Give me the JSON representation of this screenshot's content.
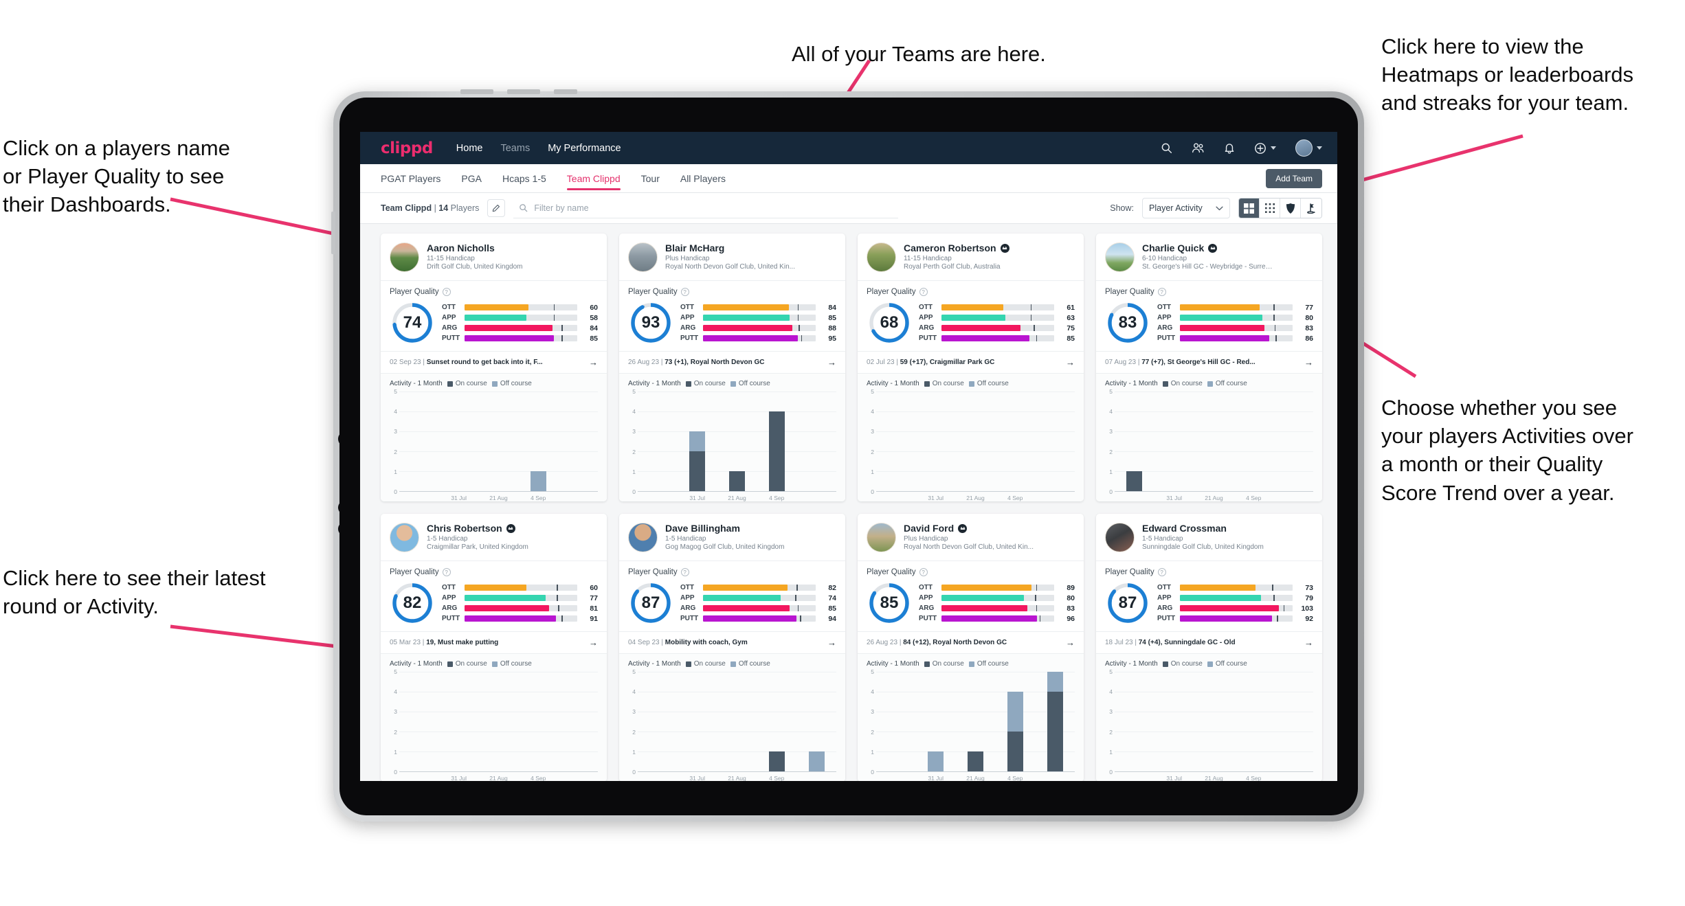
{
  "annotations": [
    {
      "id": "a-top",
      "text": "All of your Teams are here."
    },
    {
      "id": "a-topright",
      "text": "Click here to view the\nHeatmaps or leaderboards\nand streaks for your team."
    },
    {
      "id": "a-left",
      "text": "Click on a players name\nor Player Quality to see\ntheir Dashboards."
    },
    {
      "id": "a-right",
      "text": "Choose whether you see\nyour players Activities over\na month or their Quality\nScore Trend over a year."
    },
    {
      "id": "a-bottomleft",
      "text": "Click here to see their latest\nround or Activity."
    }
  ],
  "colors": {
    "accent_pink": "#e4316c",
    "navbar_bg": "#16283a",
    "ring_blue": "#1c7fd4",
    "ott": "#f5a623",
    "app": "#35d5b0",
    "arg": "#f2175f",
    "putt": "#b915d0",
    "on_course": "#4a5a68",
    "off_course": "#8fa8bf"
  },
  "navbar": {
    "logo": "clippd",
    "links": [
      {
        "label": "Home",
        "state": "active"
      },
      {
        "label": "Teams",
        "state": "dim"
      },
      {
        "label": "My Performance",
        "state": "active"
      }
    ],
    "icons": [
      "search-icon",
      "people-icon",
      "bell-icon",
      "plus-circle-icon",
      "avatar"
    ]
  },
  "tabs": {
    "items": [
      {
        "label": "PGAT Players",
        "selected": false
      },
      {
        "label": "PGA",
        "selected": false
      },
      {
        "label": "Hcaps 1-5",
        "selected": false
      },
      {
        "label": "Team Clippd",
        "selected": true
      },
      {
        "label": "Tour",
        "selected": false
      },
      {
        "label": "All Players",
        "selected": false
      }
    ],
    "add_team_label": "Add Team"
  },
  "filterbar": {
    "team_name": "Team Clippd",
    "separator": " | ",
    "player_count": "14",
    "players_word": " Players",
    "edit_icon": "pencil-icon",
    "search_placeholder": "Filter by name",
    "show_label": "Show:",
    "show_value": "Player Activity",
    "view_buttons": [
      {
        "name": "grid-large-icon",
        "active": true
      },
      {
        "name": "grid-small-icon",
        "active": false
      },
      {
        "name": "heatmap-shield-icon",
        "active": false
      },
      {
        "name": "flag-leaderboard-icon",
        "active": false
      }
    ]
  },
  "card_labels": {
    "player_quality": "Player Quality",
    "activity": "Activity - 1 Month",
    "on_course": "On course",
    "off_course": "Off course",
    "skills": [
      "OTT",
      "APP",
      "ARG",
      "PUTT"
    ],
    "arrow": "→"
  },
  "chart_data": {
    "type": "bar",
    "title": "Activity - 1 Month",
    "ylabel": "",
    "xlabel": "",
    "ylim": [
      0,
      5
    ],
    "yticks": [
      0,
      1,
      2,
      3,
      4,
      5
    ],
    "categories": [
      "31 Jul",
      "21 Aug",
      "4 Sep"
    ],
    "xtick_labels": [
      "31 Jul",
      "21 Aug",
      "4 Sep"
    ],
    "legend": [
      "On course",
      "Off course"
    ],
    "legend_position": "top",
    "grid": true,
    "per_player": [
      {
        "player": "Aaron Nicholls",
        "bars": [
          {
            "slot": 0,
            "on": 0,
            "off": 0
          },
          {
            "slot": 1,
            "on": 0,
            "off": 0
          },
          {
            "slot": 2,
            "on": 0,
            "off": 0
          },
          {
            "slot": 3,
            "on": 0,
            "off": 1
          },
          {
            "slot": 4,
            "on": 0,
            "off": 0
          }
        ]
      },
      {
        "player": "Blair McHarg",
        "bars": [
          {
            "slot": 0,
            "on": 0,
            "off": 0
          },
          {
            "slot": 1,
            "on": 2,
            "off": 1
          },
          {
            "slot": 2,
            "on": 1,
            "off": 0
          },
          {
            "slot": 3,
            "on": 4,
            "off": 0
          },
          {
            "slot": 4,
            "on": 0,
            "off": 0
          }
        ]
      },
      {
        "player": "Cameron Robertson",
        "bars": [
          {
            "slot": 0,
            "on": 0,
            "off": 0
          },
          {
            "slot": 1,
            "on": 0,
            "off": 0
          },
          {
            "slot": 2,
            "on": 0,
            "off": 0
          },
          {
            "slot": 3,
            "on": 0,
            "off": 0
          },
          {
            "slot": 4,
            "on": 0,
            "off": 0
          }
        ]
      },
      {
        "player": "Charlie Quick",
        "bars": [
          {
            "slot": 0,
            "on": 1,
            "off": 0
          },
          {
            "slot": 1,
            "on": 0,
            "off": 0
          },
          {
            "slot": 2,
            "on": 0,
            "off": 0
          },
          {
            "slot": 3,
            "on": 0,
            "off": 0
          },
          {
            "slot": 4,
            "on": 0,
            "off": 0
          }
        ]
      },
      {
        "player": "Chris Robertson",
        "bars": [
          {
            "slot": 0,
            "on": 0,
            "off": 0
          },
          {
            "slot": 1,
            "on": 0,
            "off": 0
          },
          {
            "slot": 2,
            "on": 0,
            "off": 0
          },
          {
            "slot": 3,
            "on": 0,
            "off": 0
          },
          {
            "slot": 4,
            "on": 0,
            "off": 0
          }
        ]
      },
      {
        "player": "Dave Billingham",
        "bars": [
          {
            "slot": 0,
            "on": 0,
            "off": 0
          },
          {
            "slot": 1,
            "on": 0,
            "off": 0
          },
          {
            "slot": 2,
            "on": 0,
            "off": 0
          },
          {
            "slot": 3,
            "on": 1,
            "off": 0
          },
          {
            "slot": 4,
            "on": 0,
            "off": 1
          }
        ]
      },
      {
        "player": "David Ford",
        "bars": [
          {
            "slot": 0,
            "on": 0,
            "off": 0
          },
          {
            "slot": 1,
            "on": 0,
            "off": 1
          },
          {
            "slot": 2,
            "on": 1,
            "off": 0
          },
          {
            "slot": 3,
            "on": 2,
            "off": 2
          },
          {
            "slot": 4,
            "on": 4,
            "off": 1
          }
        ]
      },
      {
        "player": "Edward Crossman",
        "bars": [
          {
            "slot": 0,
            "on": 0,
            "off": 0
          },
          {
            "slot": 1,
            "on": 0,
            "off": 0
          },
          {
            "slot": 2,
            "on": 0,
            "off": 0
          },
          {
            "slot": 3,
            "on": 0,
            "off": 0
          },
          {
            "slot": 4,
            "on": 0,
            "off": 0
          }
        ]
      }
    ]
  },
  "players": [
    {
      "name": "Aaron Nicholls",
      "verified": false,
      "handicap": "11-15 Handicap",
      "club": "Drift Golf Club, United Kingdom",
      "quality": 74,
      "skills": [
        {
          "label": "OTT",
          "value": 60,
          "fill": 57,
          "tick": 79
        },
        {
          "label": "APP",
          "value": 58,
          "fill": 55,
          "tick": 79
        },
        {
          "label": "ARG",
          "value": 84,
          "fill": 78,
          "tick": 86
        },
        {
          "label": "PUTT",
          "value": 85,
          "fill": 79,
          "tick": 86
        }
      ],
      "latest_date": "02 Sep 23",
      "latest_text": "Sunset round to get back into it, F...",
      "avatar_style": "sunset-course"
    },
    {
      "name": "Blair McHarg",
      "verified": false,
      "handicap": "Plus Handicap",
      "club": "Royal North Devon Golf Club, United Kin...",
      "quality": 93,
      "skills": [
        {
          "label": "OTT",
          "value": 84,
          "fill": 76,
          "tick": 84
        },
        {
          "label": "APP",
          "value": 85,
          "fill": 77,
          "tick": 84
        },
        {
          "label": "ARG",
          "value": 88,
          "fill": 79,
          "tick": 85
        },
        {
          "label": "PUTT",
          "value": 95,
          "fill": 84,
          "tick": 87
        }
      ],
      "latest_date": "26 Aug 23",
      "latest_text": "73 (+1), Royal North Devon GC",
      "avatar_style": "grey-golfer"
    },
    {
      "name": "Cameron Robertson",
      "verified": true,
      "handicap": "11-15 Handicap",
      "club": "Royal Perth Golf Club, Australia",
      "quality": 68,
      "skills": [
        {
          "label": "OTT",
          "value": 61,
          "fill": 55,
          "tick": 79
        },
        {
          "label": "APP",
          "value": 63,
          "fill": 57,
          "tick": 79
        },
        {
          "label": "ARG",
          "value": 75,
          "fill": 70,
          "tick": 82
        },
        {
          "label": "PUTT",
          "value": 85,
          "fill": 78,
          "tick": 84
        }
      ],
      "latest_date": "02 Jul 23",
      "latest_text": "59 (+17), Craigmillar Park GC",
      "avatar_style": "tree-course"
    },
    {
      "name": "Charlie Quick",
      "verified": true,
      "handicap": "6-10 Handicap",
      "club": "St. George's Hill GC - Weybridge - Surrey, ...",
      "quality": 83,
      "skills": [
        {
          "label": "OTT",
          "value": 77,
          "fill": 71,
          "tick": 83
        },
        {
          "label": "APP",
          "value": 80,
          "fill": 73,
          "tick": 83
        },
        {
          "label": "ARG",
          "value": 83,
          "fill": 75,
          "tick": 84
        },
        {
          "label": "PUTT",
          "value": 86,
          "fill": 79,
          "tick": 85
        }
      ],
      "latest_date": "07 Aug 23",
      "latest_text": "77 (+7), St George's Hill GC - Red...",
      "avatar_style": "blue-sky-course"
    },
    {
      "name": "Chris Robertson",
      "verified": true,
      "handicap": "1-5 Handicap",
      "club": "Craigmillar Park, United Kingdom",
      "quality": 82,
      "skills": [
        {
          "label": "OTT",
          "value": 60,
          "fill": 55,
          "tick": 82
        },
        {
          "label": "APP",
          "value": 77,
          "fill": 72,
          "tick": 82
        },
        {
          "label": "ARG",
          "value": 81,
          "fill": 75,
          "tick": 83
        },
        {
          "label": "PUTT",
          "value": 91,
          "fill": 81,
          "tick": 86
        }
      ],
      "latest_date": "05 Mar 23",
      "latest_text": "19, Must make putting",
      "avatar_style": "man-blue-shirt"
    },
    {
      "name": "Dave Billingham",
      "verified": false,
      "handicap": "1-5 Handicap",
      "club": "Gog Magog Golf Club, United Kingdom",
      "quality": 87,
      "skills": [
        {
          "label": "OTT",
          "value": 82,
          "fill": 75,
          "tick": 83
        },
        {
          "label": "APP",
          "value": 74,
          "fill": 69,
          "tick": 82
        },
        {
          "label": "ARG",
          "value": 85,
          "fill": 77,
          "tick": 84
        },
        {
          "label": "PUTT",
          "value": 94,
          "fill": 83,
          "tick": 86
        }
      ],
      "latest_date": "04 Sep 23",
      "latest_text": "Mobility with coach, Gym",
      "avatar_style": "man-beard"
    },
    {
      "name": "David Ford",
      "verified": true,
      "handicap": "Plus Handicap",
      "club": "Royal North Devon Golf Club, United Kin...",
      "quality": 85,
      "skills": [
        {
          "label": "OTT",
          "value": 89,
          "fill": 80,
          "tick": 84
        },
        {
          "label": "APP",
          "value": 80,
          "fill": 73,
          "tick": 83
        },
        {
          "label": "ARG",
          "value": 83,
          "fill": 76,
          "tick": 84
        },
        {
          "label": "PUTT",
          "value": 96,
          "fill": 85,
          "tick": 87
        }
      ],
      "latest_date": "26 Aug 23",
      "latest_text": "84 (+12), Royal North Devon GC",
      "avatar_style": "links-course"
    },
    {
      "name": "Edward Crossman",
      "verified": false,
      "handicap": "1-5 Handicap",
      "club": "Sunningdale Golf Club, United Kingdom",
      "quality": 87,
      "skills": [
        {
          "label": "OTT",
          "value": 73,
          "fill": 67,
          "tick": 82
        },
        {
          "label": "APP",
          "value": 79,
          "fill": 72,
          "tick": 83
        },
        {
          "label": "ARG",
          "value": 103,
          "fill": 88,
          "tick": 92
        },
        {
          "label": "PUTT",
          "value": 92,
          "fill": 82,
          "tick": 86
        }
      ],
      "latest_date": "18 Jul 23",
      "latest_text": "74 (+4), Sunningdale GC - Old",
      "avatar_style": "dark-indoor"
    }
  ]
}
